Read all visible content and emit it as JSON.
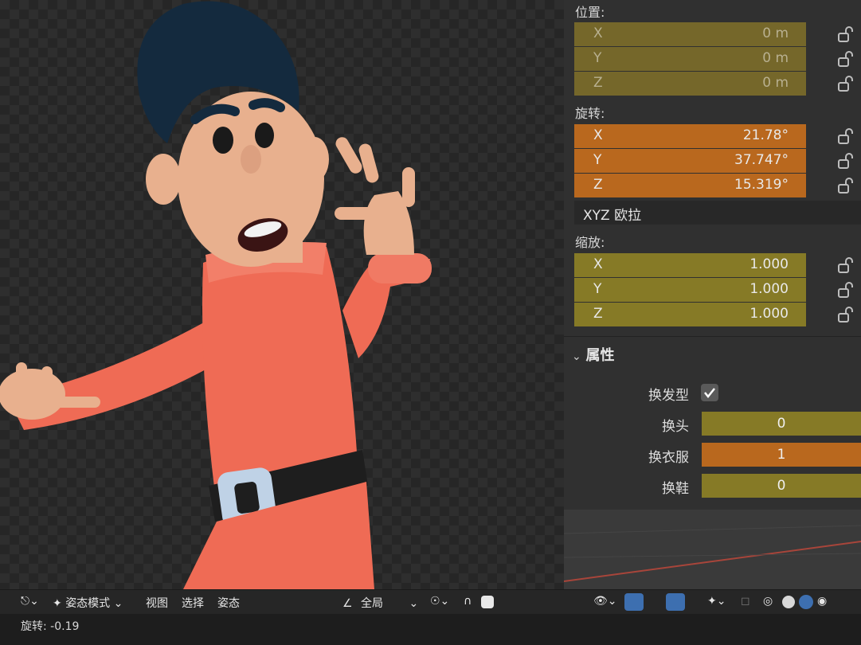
{
  "transform": {
    "location_label": "位置:",
    "location": [
      {
        "axis": "X",
        "value": "0 m"
      },
      {
        "axis": "Y",
        "value": "0 m"
      },
      {
        "axis": "Z",
        "value": "0 m"
      }
    ],
    "rotation_label": "旋转:",
    "rotation": [
      {
        "axis": "X",
        "value": "21.78°"
      },
      {
        "axis": "Y",
        "value": "37.747°"
      },
      {
        "axis": "Z",
        "value": "15.319°"
      }
    ],
    "rotation_mode": "XYZ 欧拉",
    "scale_label": "缩放:",
    "scale": [
      {
        "axis": "X",
        "value": "1.000"
      },
      {
        "axis": "Y",
        "value": "1.000"
      },
      {
        "axis": "Z",
        "value": "1.000"
      }
    ]
  },
  "properties": {
    "header": "属性",
    "items": [
      {
        "label": "换发型",
        "type": "checkbox",
        "checked": true
      },
      {
        "label": "换头",
        "value": "0"
      },
      {
        "label": "换衣服",
        "value": "1"
      },
      {
        "label": "换鞋",
        "value": "0"
      }
    ]
  },
  "toolbar": {
    "mode": "姿态模式",
    "menus": [
      "视图",
      "选择",
      "姿态"
    ],
    "orientation": "全局"
  },
  "status": {
    "text": "旋转: -0.19"
  },
  "colors": {
    "rotation_field": "#b9681e",
    "scale_field": "#867a26",
    "location_field": "#75672a",
    "panel_bg": "#303030"
  }
}
